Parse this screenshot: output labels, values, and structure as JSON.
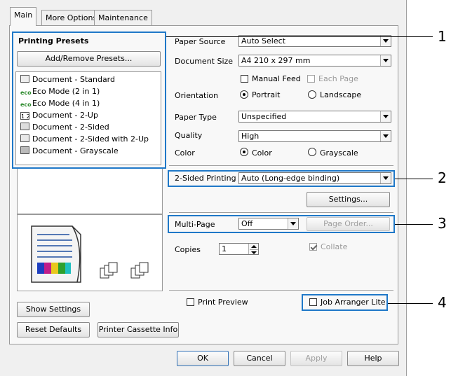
{
  "tabs": [
    {
      "label": "Main",
      "active": true
    },
    {
      "label": "More Options",
      "active": false
    },
    {
      "label": "Maintenance",
      "active": false
    }
  ],
  "presets": {
    "title": "Printing Presets",
    "add_remove": "Add/Remove Presets...",
    "items": [
      {
        "label": "Document - Standard",
        "icon": "document-icon"
      },
      {
        "label": "Eco Mode (2 in 1)",
        "icon": "eco-icon"
      },
      {
        "label": "Eco Mode (4 in 1)",
        "icon": "eco-icon"
      },
      {
        "label": "Document - 2-Up",
        "icon": "two-up-icon"
      },
      {
        "label": "Document - 2-Sided",
        "icon": "two-sided-icon"
      },
      {
        "label": "Document - 2-Sided with 2-Up",
        "icon": "two-sided-two-up-icon"
      },
      {
        "label": "Document - Grayscale",
        "icon": "grayscale-icon"
      }
    ]
  },
  "buttons": {
    "show_settings": "Show Settings",
    "reset_defaults": "Reset Defaults",
    "printer_cassette_info": "Printer Cassette Info",
    "ok": "OK",
    "cancel": "Cancel",
    "apply": "Apply",
    "help": "Help",
    "settings": "Settings...",
    "page_order": "Page Order..."
  },
  "settings": {
    "paper_source": {
      "label": "Paper Source",
      "value": "Auto Select"
    },
    "document_size": {
      "label": "Document Size",
      "value": "A4 210 x 297 mm"
    },
    "manual_feed": "Manual Feed",
    "each_page": "Each Page",
    "orientation": {
      "label": "Orientation",
      "portrait": "Portrait",
      "landscape": "Landscape"
    },
    "paper_type": {
      "label": "Paper Type",
      "value": "Unspecified"
    },
    "quality": {
      "label": "Quality",
      "value": "High"
    },
    "color": {
      "label": "Color",
      "color": "Color",
      "grayscale": "Grayscale"
    },
    "two_sided": {
      "label": "2-Sided Printing",
      "value": "Auto (Long-edge binding)"
    },
    "multi_page": {
      "label": "Multi-Page",
      "value": "Off"
    },
    "copies": {
      "label": "Copies",
      "value": "1"
    },
    "collate": "Collate",
    "print_preview": "Print Preview",
    "job_arranger": "Job Arranger Lite"
  },
  "callouts": [
    "1",
    "2",
    "3",
    "4"
  ],
  "colors": {
    "highlight": "#1f78c8",
    "dialog_bg": "#f0f0f0"
  }
}
